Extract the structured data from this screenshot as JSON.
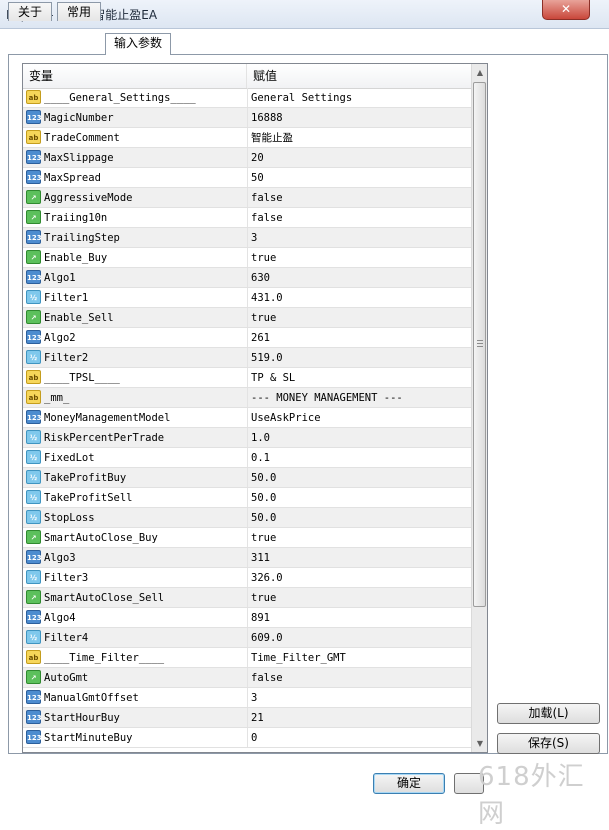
{
  "window": {
    "title": "Expert - 高胜率智能止盈EA",
    "close_glyph": "✕"
  },
  "tabs": [
    {
      "label": "关于"
    },
    {
      "label": "常用"
    },
    {
      "label": "输入参数"
    }
  ],
  "grid": {
    "headers": {
      "variable": "变量",
      "value": "赋值"
    },
    "rows": [
      {
        "type": "ab",
        "name": "____General_Settings____",
        "value": "General Settings"
      },
      {
        "type": "123",
        "name": "MagicNumber",
        "value": "16888"
      },
      {
        "type": "ab",
        "name": "TradeComment",
        "value": "智能止盈"
      },
      {
        "type": "123",
        "name": "MaxSlippage",
        "value": "20"
      },
      {
        "type": "123",
        "name": "MaxSpread",
        "value": "50"
      },
      {
        "type": "bool",
        "name": "AggressiveMode",
        "value": "false"
      },
      {
        "type": "bool",
        "name": "Traiing10n",
        "value": "false"
      },
      {
        "type": "123",
        "name": "TrailingStep",
        "value": "3"
      },
      {
        "type": "bool",
        "name": "Enable_Buy",
        "value": "true"
      },
      {
        "type": "123",
        "name": "Algo1",
        "value": "630"
      },
      {
        "type": "dbl",
        "name": "Filter1",
        "value": "431.0"
      },
      {
        "type": "bool",
        "name": "Enable_Sell",
        "value": "true"
      },
      {
        "type": "123",
        "name": "Algo2",
        "value": "261"
      },
      {
        "type": "dbl",
        "name": "Filter2",
        "value": "519.0"
      },
      {
        "type": "ab",
        "name": "____TPSL____",
        "value": "TP & SL"
      },
      {
        "type": "ab",
        "name": "_mm_",
        "value": "--- MONEY MANAGEMENT ---"
      },
      {
        "type": "123",
        "name": "MoneyManagementModel",
        "value": "UseAskPrice"
      },
      {
        "type": "dbl",
        "name": "RiskPercentPerTrade",
        "value": "1.0"
      },
      {
        "type": "dbl",
        "name": "FixedLot",
        "value": "0.1"
      },
      {
        "type": "dbl",
        "name": "TakeProfitBuy",
        "value": "50.0"
      },
      {
        "type": "dbl",
        "name": "TakeProfitSell",
        "value": "50.0"
      },
      {
        "type": "dbl",
        "name": "StopLoss",
        "value": "50.0"
      },
      {
        "type": "bool",
        "name": "SmartAutoClose_Buy",
        "value": "true"
      },
      {
        "type": "123",
        "name": "Algo3",
        "value": "311"
      },
      {
        "type": "dbl",
        "name": "Filter3",
        "value": "326.0"
      },
      {
        "type": "bool",
        "name": "SmartAutoClose_Sell",
        "value": "true"
      },
      {
        "type": "123",
        "name": "Algo4",
        "value": "891"
      },
      {
        "type": "dbl",
        "name": "Filter4",
        "value": "609.0"
      },
      {
        "type": "ab",
        "name": "____Time_Filter____",
        "value": "Time_Filter_GMT"
      },
      {
        "type": "bool",
        "name": "AutoGmt",
        "value": "false"
      },
      {
        "type": "123",
        "name": "ManualGmtOffset",
        "value": "3"
      },
      {
        "type": "123",
        "name": "StartHourBuy",
        "value": "21"
      },
      {
        "type": "123",
        "name": "StartMinuteBuy",
        "value": "0"
      }
    ],
    "icon_glyphs": {
      "ab": "ab",
      "123": "123",
      "bool": "↗",
      "dbl": "½"
    },
    "icon_names": {
      "ab": "string-type-icon",
      "123": "integer-type-icon",
      "bool": "boolean-type-icon",
      "dbl": "double-type-icon"
    }
  },
  "buttons": {
    "load": "加载(L)",
    "save": "保存(S)",
    "ok": "确定"
  },
  "watermark": "618外汇网"
}
